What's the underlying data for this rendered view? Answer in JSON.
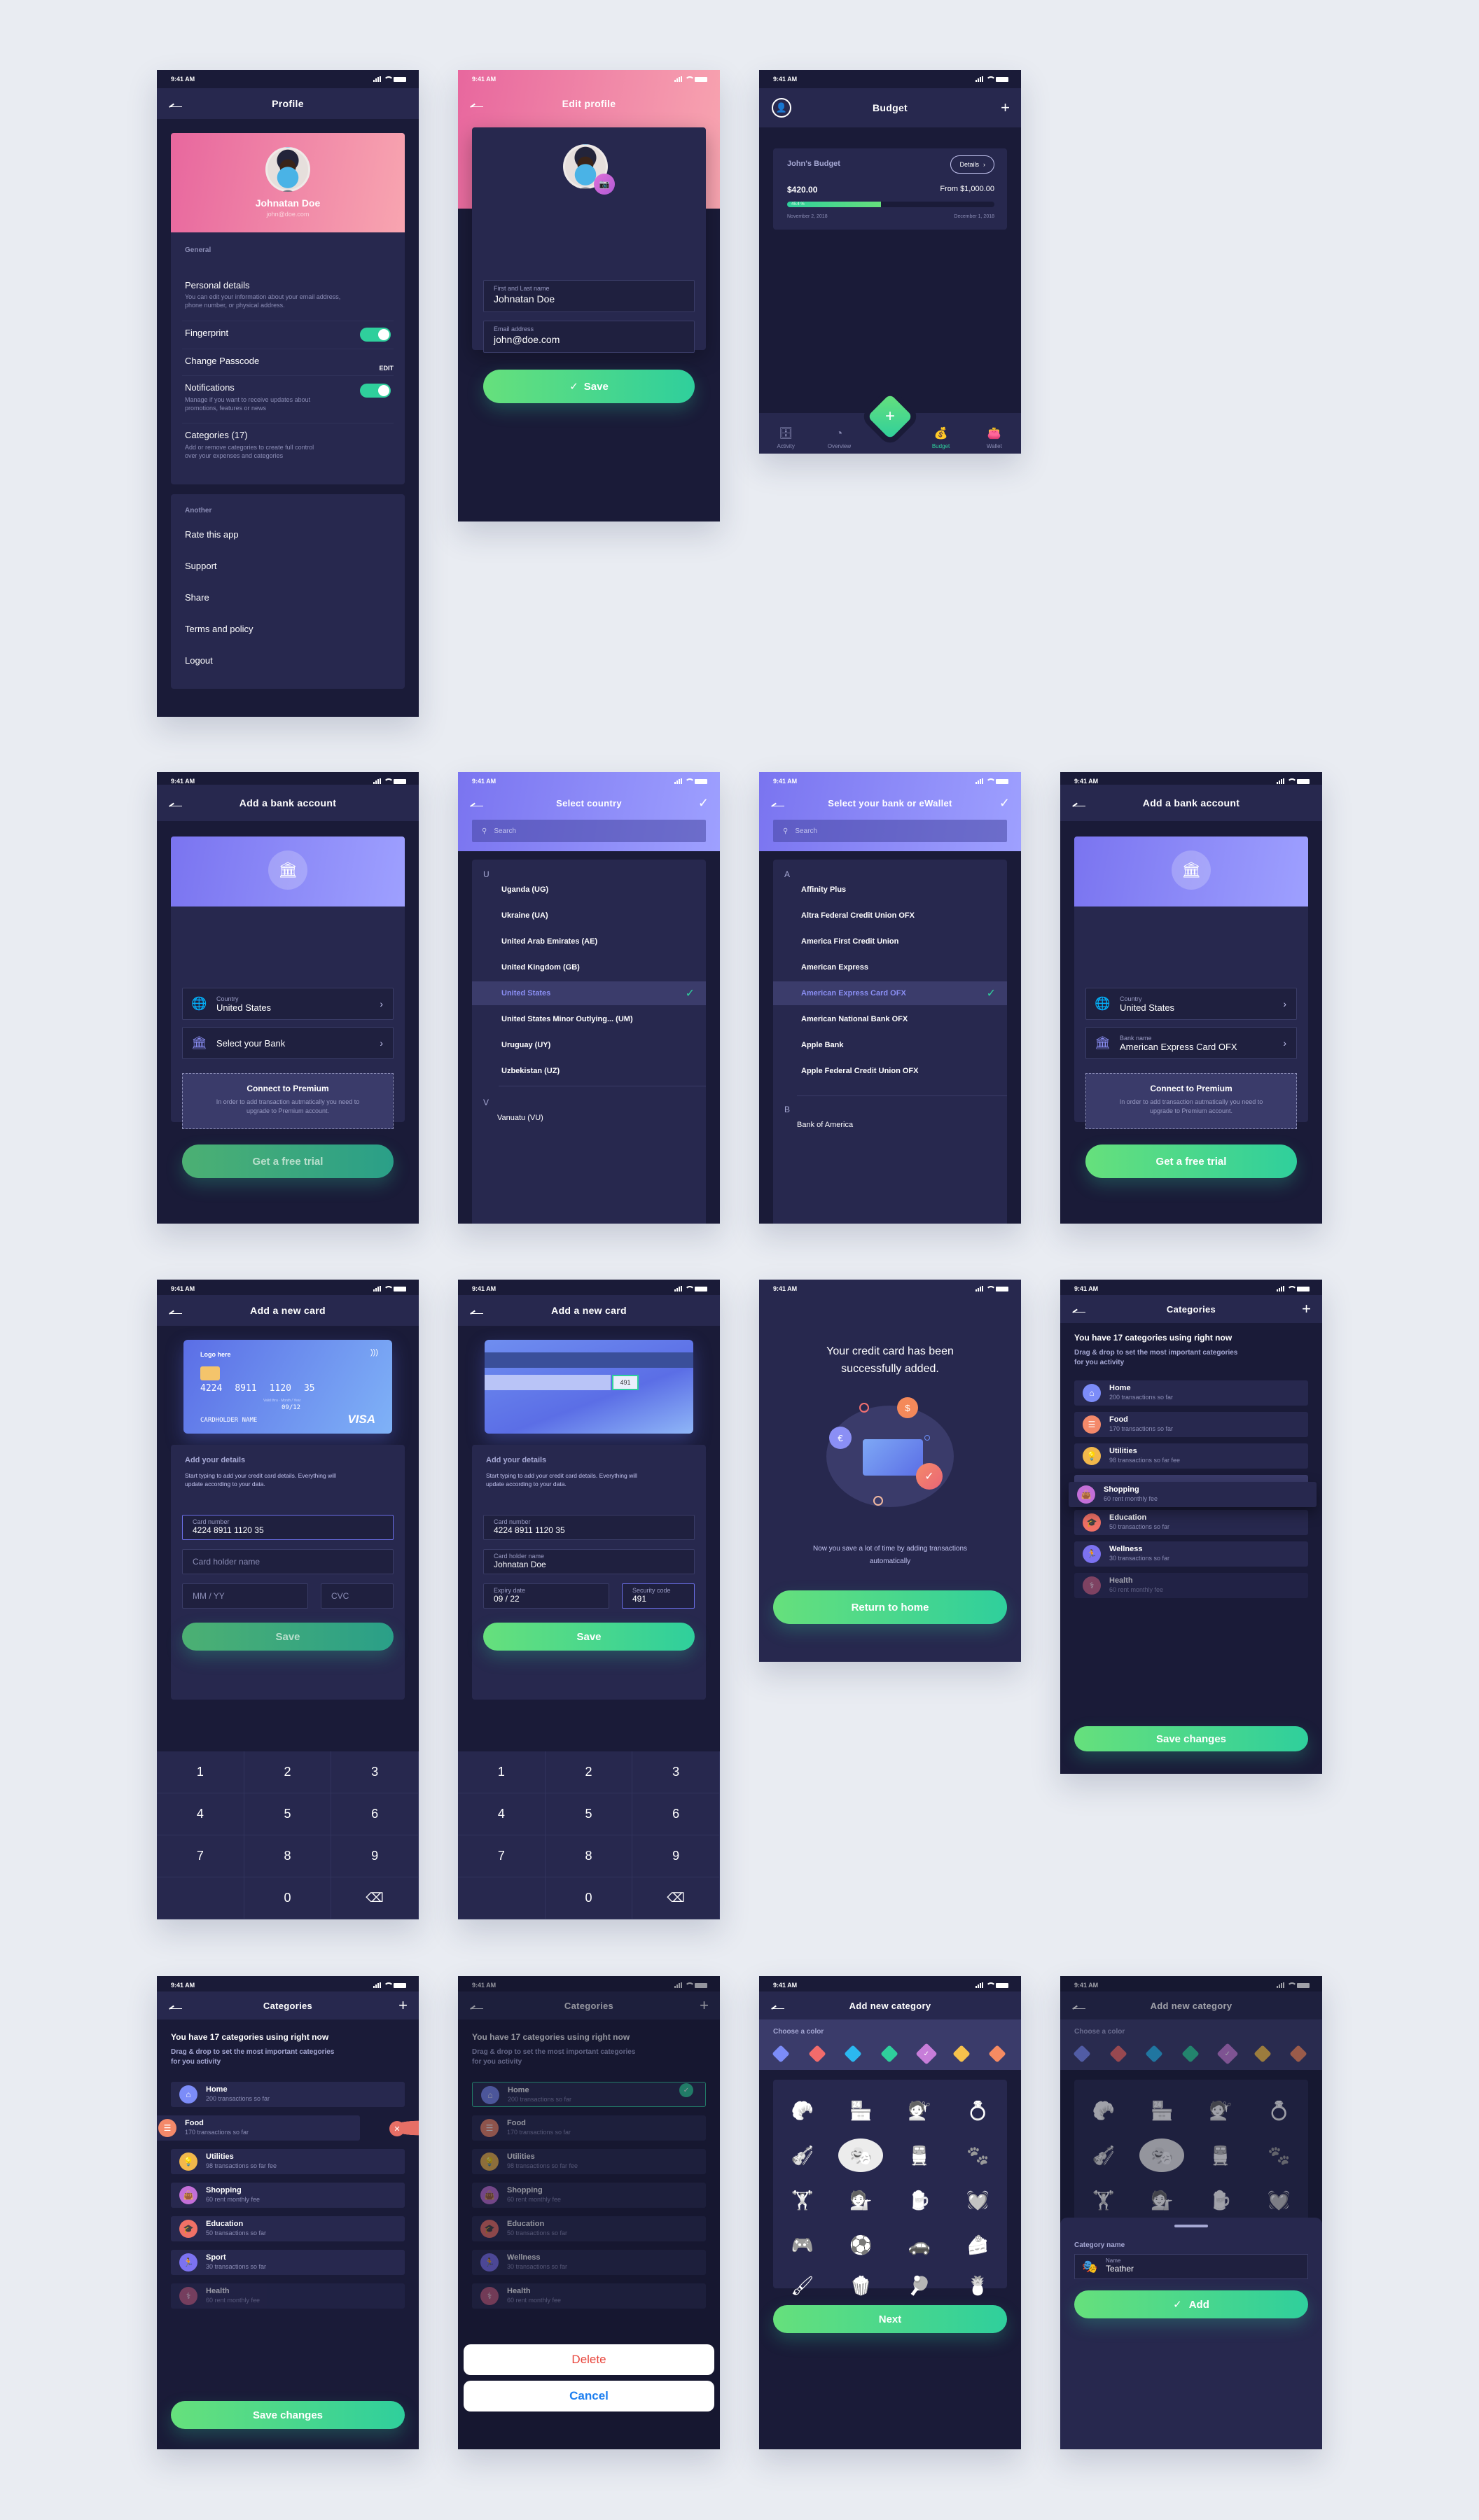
{
  "status_time": "9:41 AM",
  "profile": {
    "title": "Profile",
    "name": "Johnatan Doe",
    "email": "john@doe.com",
    "general_label": "General",
    "personal_details": "Personal details",
    "personal_details_sub": "You can edit your information about your email address, phone number, or physical address.",
    "fingerprint": "Fingerprint",
    "fingerprint_on": true,
    "change_passcode": "Change Passcode",
    "edit_label": "EDIT",
    "notifications": "Notifications",
    "notifications_on": true,
    "notifications_sub": "Manage if you want to receive updates about promotions, features or news",
    "categories": "Categories (17)",
    "categories_sub": "Add or remove categories to create full control over your expenses and categories",
    "another_label": "Another",
    "another_items": [
      "Rate this app",
      "Support",
      "Share",
      "Terms and policy",
      "Logout"
    ]
  },
  "edit_profile": {
    "title": "Edit profile",
    "name_label": "First and Last name",
    "name_value": "Johnatan Doe",
    "email_label": "Email address",
    "email_value": "john@doe.com",
    "save": "Save"
  },
  "budget": {
    "title": "Budget",
    "card_title": "John's Budget",
    "details": "Details",
    "spent": "$420.00",
    "total": "From $1,000.00",
    "progress_label": "45.4 %",
    "progress_percent": 45.4,
    "start_date": "November 2, 2018",
    "end_date": "December 1, 2018",
    "tabs": [
      {
        "label": "Activity",
        "icon": "archive-icon",
        "active": false
      },
      {
        "label": "Overview",
        "icon": "pie-chart-icon",
        "active": false
      },
      {
        "label": "Budget",
        "icon": "money-bag-icon",
        "active": true
      },
      {
        "label": "Wallet",
        "icon": "wallet-icon",
        "active": false
      }
    ]
  },
  "add_bank": {
    "title": "Add a bank account",
    "country_label": "Country",
    "country_value": "United States",
    "select_bank": "Select your Bank",
    "bank_name_label": "Bank name",
    "bank_name_value": "American Express Card OFX",
    "premium_title": "Connect to Premium",
    "premium_desc": "In order to add transaction autmatically you need to upgrade to Premium account.",
    "free_trial": "Get a free trial"
  },
  "select_country": {
    "title": "Select country",
    "search_placeholder": "Search",
    "sections": [
      {
        "letter": "U",
        "items": [
          "Uganda (UG)",
          "Ukraine (UA)",
          "United Arab Emirates (AE)",
          "United Kingdom (GB)",
          "United States",
          "United States Minor Outlying... (UM)",
          "Uruguay (UY)",
          "Uzbekistan (UZ)"
        ]
      },
      {
        "letter": "V",
        "items": [
          "Vanuatu (VU)"
        ]
      }
    ],
    "selected": "United States"
  },
  "select_bank": {
    "title": "Select your bank or eWallet",
    "search_placeholder": "Search",
    "sections": [
      {
        "letter": "A",
        "items": [
          "Affinity Plus",
          "Altra Federal Credit Union OFX",
          "America First Credit Union",
          "American Express",
          "American Express Card OFX",
          "American National Bank OFX",
          "Apple Bank",
          "Apple Federal Credit Union OFX"
        ]
      },
      {
        "letter": "B",
        "items": [
          "Bank of America"
        ]
      }
    ],
    "selected": "American Express Card OFX"
  },
  "new_card": {
    "title": "Add a new card",
    "card_logo": "Logo here",
    "card_number_display": [
      "4224",
      "8911",
      "1120",
      "35"
    ],
    "valid_thru": "Valid thru",
    "month_year": "Month / Year",
    "expiry_display": "09/12",
    "holder_display": "CARDHOLDER NAME",
    "brand": "VISA",
    "cvc_display": "491",
    "details_title": "Add your details",
    "details_desc": "Start typing to add your credit card details. Everything will update according to your data.",
    "card_number_label": "Card number",
    "card_number_value": "4224  8911  1120  35",
    "holder_placeholder": "Card holder name",
    "holder_label": "Card holder name",
    "holder_value": "Johnatan Doe",
    "expiry_placeholder": "MM / YY",
    "expiry_label": "Expiry date",
    "expiry_value": "09 / 22",
    "cvc_placeholder": "CVC",
    "cvc_label": "Security code",
    "cvc_value": "491",
    "save": "Save",
    "keys": [
      "1",
      "2",
      "3",
      "4",
      "5",
      "6",
      "7",
      "8",
      "9",
      "",
      "0",
      "⌫"
    ]
  },
  "success": {
    "title": "Your credit card has been successfully added.",
    "desc": "Now you save a lot of time by adding transactions automatically",
    "button": "Return to home"
  },
  "categories": {
    "title": "Categories",
    "heading": "You have 17 categories using right now",
    "desc": "Drag & drop to set the most important categories for you activity",
    "save": "Save changes",
    "items_a": [
      {
        "name": "Home",
        "sub": "200 transactions so far",
        "icon": "⌂",
        "color": "#7c8cf8"
      },
      {
        "name": "Food",
        "sub": "170 transactions so far",
        "icon": "☰",
        "color": "#f4896a"
      },
      {
        "name": "Utilities",
        "sub": "98 transactions so far fee",
        "icon": "💡",
        "color": "#f2b84b"
      },
      {
        "name": "Shopping",
        "sub": "60 rent monthly fee",
        "icon": "👜",
        "color": "#c36fd8"
      },
      {
        "name": "Education",
        "sub": "50 transactions so far",
        "icon": "🎓",
        "color": "#f07166"
      },
      {
        "name": "Wellness",
        "sub": "30 transactions so far",
        "icon": "🏃",
        "color": "#7c72f0"
      },
      {
        "name": "Health",
        "sub": "60 rent monthly fee",
        "icon": "⚕",
        "color": "#c15c7e"
      }
    ],
    "items_b": [
      {
        "name": "Home",
        "sub": "200 transactions so far",
        "icon": "⌂",
        "color": "#7c8cf8"
      },
      {
        "name": "Food",
        "sub": "170 transactions so far",
        "icon": "☰",
        "color": "#f4896a"
      },
      {
        "name": "Utilities",
        "sub": "98 transactions so far fee",
        "icon": "💡",
        "color": "#f2b84b"
      },
      {
        "name": "Shopping",
        "sub": "60 rent monthly fee",
        "icon": "👜",
        "color": "#c36fd8"
      },
      {
        "name": "Education",
        "sub": "50 transactions so far",
        "icon": "🎓",
        "color": "#f07166"
      },
      {
        "name": "Sport",
        "sub": "30 transactions so far",
        "icon": "🏃",
        "color": "#7c72f0"
      },
      {
        "name": "Health",
        "sub": "60 rent monthly fee",
        "icon": "⚕",
        "color": "#c15c7e"
      }
    ],
    "delete": "Delete",
    "cancel": "Cancel"
  },
  "new_category": {
    "title": "Add new category",
    "choose_color": "Choose a color",
    "colors": [
      "#7c8cf8",
      "#f26b6b",
      "#2bb8f0",
      "#2fcf9c",
      "#c77dd9",
      "#f7c24c",
      "#f68b62"
    ],
    "selected_color_index": 4,
    "icons": [
      {
        "name": "croissant-icon",
        "glyph": "🥐"
      },
      {
        "name": "shop-icon",
        "glyph": "🏪"
      },
      {
        "name": "hair-salon-icon",
        "glyph": "💇"
      },
      {
        "name": "ring-icon",
        "glyph": "💍"
      },
      {
        "name": "violin-icon",
        "glyph": "🎻"
      },
      {
        "name": "theater-masks-icon",
        "glyph": "🎭"
      },
      {
        "name": "train-icon",
        "glyph": "🚆"
      },
      {
        "name": "paw-icon",
        "glyph": "🐾"
      },
      {
        "name": "dumbbell-icon",
        "glyph": "🏋"
      },
      {
        "name": "hair-icon",
        "glyph": "💁"
      },
      {
        "name": "beer-icon",
        "glyph": "🍺"
      },
      {
        "name": "heartbeat-icon",
        "glyph": "💓"
      },
      {
        "name": "gamepad-icon",
        "glyph": "🎮"
      },
      {
        "name": "soccer-ball-icon",
        "glyph": "⚽"
      },
      {
        "name": "car-icon",
        "glyph": "🚗"
      },
      {
        "name": "cake-icon",
        "glyph": "🍰"
      },
      {
        "name": "paint-roller-icon",
        "glyph": "🖌"
      },
      {
        "name": "popcorn-icon",
        "glyph": "🍿"
      },
      {
        "name": "ping-pong-icon",
        "glyph": "🏓"
      },
      {
        "name": "pineapple-icon",
        "glyph": "🍍"
      }
    ],
    "selected_icon_index": 5,
    "next": "Next",
    "category_name_label": "Category name",
    "name_label": "Name",
    "name_value": "Teather",
    "add": "Add"
  }
}
